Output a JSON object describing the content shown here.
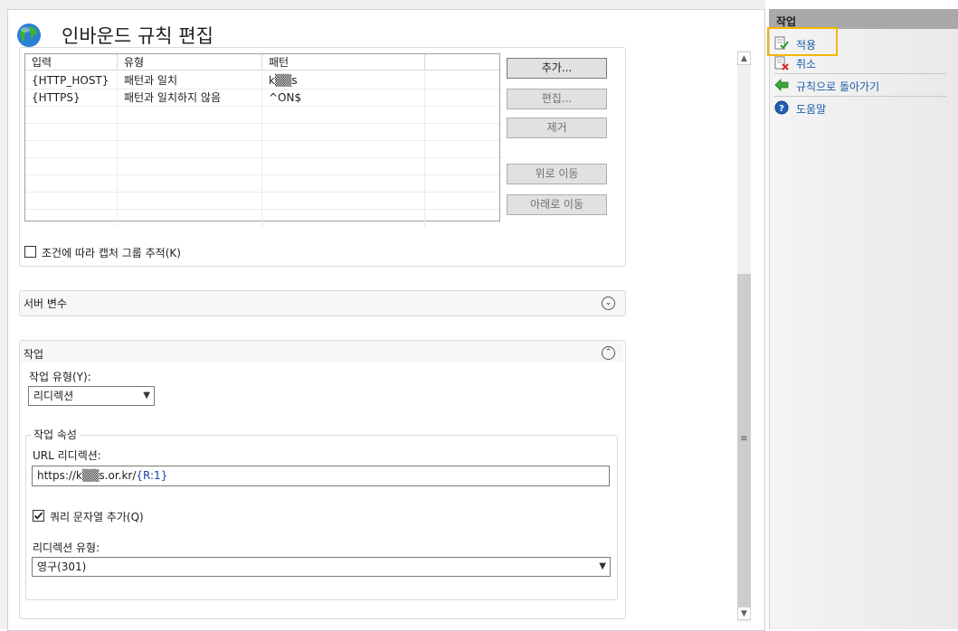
{
  "title": "인바운드 규칙 편집",
  "conditions": {
    "columns": [
      "입력",
      "유형",
      "패턴"
    ],
    "rows": [
      [
        "{HTTP_HOST}",
        "패턴과 일치",
        "k▒▒s"
      ],
      [
        "{HTTPS}",
        "패턴과 일치하지 않음",
        "^ON$"
      ]
    ],
    "buttons": {
      "add": "추가...",
      "edit": "편집...",
      "remove": "제거",
      "move_up": "위로 이동",
      "move_down": "아래로 이동"
    },
    "track_capture_label": "조건에 따라 캡처 그룹 추적(K)"
  },
  "server_variables": {
    "title": "서버 변수"
  },
  "action": {
    "section_title": "작업",
    "type_label": "작업 유형(Y):",
    "type_value": "리디렉션",
    "props_label": "작업 속성",
    "url_label": "URL 리디렉션:",
    "url_prefix": "https://k▒▒s.or.kr/",
    "url_token": "{R:1}",
    "append_query_label": "쿼리 문자열 추가(Q)",
    "redirect_type_label": "리디렉션 유형:",
    "redirect_type_value": "영구(301)"
  },
  "actions_pane": {
    "title": "작업",
    "items": [
      {
        "label": "적용",
        "icon": "apply-check-icon"
      },
      {
        "label": "취소",
        "icon": "cancel-x-icon"
      },
      {
        "label": "규칙으로 돌아가기",
        "icon": "back-arrow-icon"
      },
      {
        "label": "도움말",
        "icon": "help-icon"
      }
    ]
  },
  "colors": {
    "link": "#1a5ea8",
    "highlight": "#f7b500",
    "header_gray": "#a9a9a9"
  }
}
